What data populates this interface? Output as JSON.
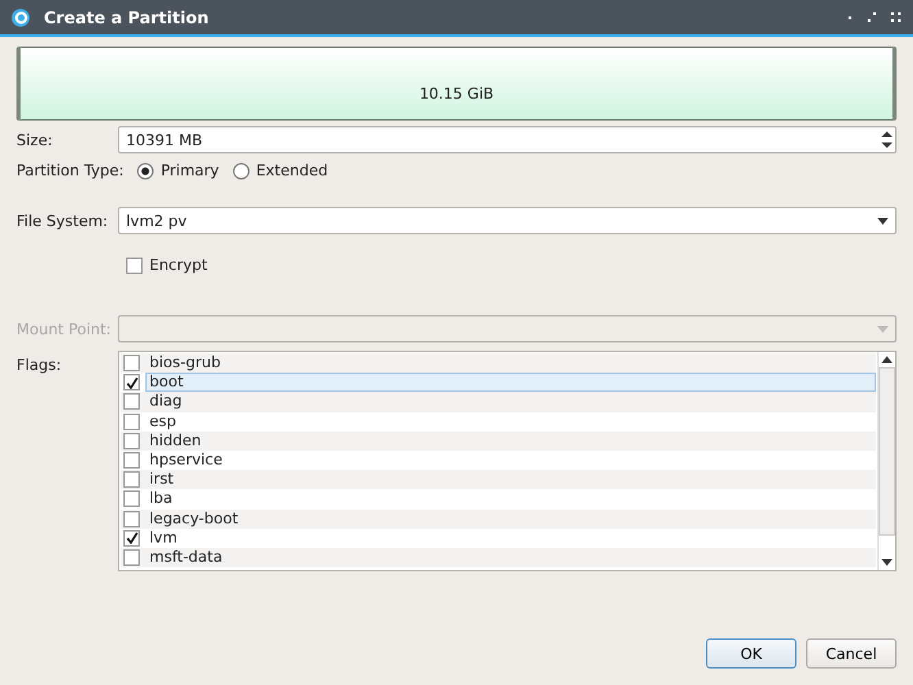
{
  "window": {
    "title": "Create a Partition"
  },
  "partition_bar": {
    "label": "10.15 GiB"
  },
  "size": {
    "label": "Size:",
    "value": "10391 MB"
  },
  "partition_type": {
    "label": "Partition Type:",
    "options": [
      {
        "label": "Primary",
        "selected": true
      },
      {
        "label": "Extended",
        "selected": false
      }
    ]
  },
  "file_system": {
    "label": "File System:",
    "value": "lvm2 pv"
  },
  "encrypt": {
    "label": "Encrypt",
    "checked": false
  },
  "mount_point": {
    "label": "Mount Point:",
    "disabled": true
  },
  "flags": {
    "label": "Flags:",
    "items": [
      {
        "label": "bios-grub",
        "checked": false,
        "selected": false
      },
      {
        "label": "boot",
        "checked": true,
        "selected": true
      },
      {
        "label": "diag",
        "checked": false,
        "selected": false
      },
      {
        "label": "esp",
        "checked": false,
        "selected": false
      },
      {
        "label": "hidden",
        "checked": false,
        "selected": false
      },
      {
        "label": "hpservice",
        "checked": false,
        "selected": false
      },
      {
        "label": "irst",
        "checked": false,
        "selected": false
      },
      {
        "label": "lba",
        "checked": false,
        "selected": false
      },
      {
        "label": "legacy-boot",
        "checked": false,
        "selected": false
      },
      {
        "label": "lvm",
        "checked": true,
        "selected": false
      },
      {
        "label": "msft-data",
        "checked": false,
        "selected": false
      }
    ]
  },
  "buttons": [
    {
      "label": "OK",
      "kind": "default"
    },
    {
      "label": "Cancel",
      "kind": "normal"
    }
  ]
}
